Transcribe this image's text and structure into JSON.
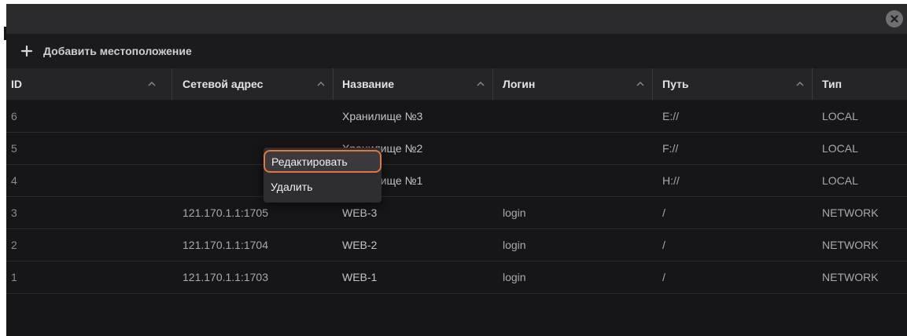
{
  "window": {
    "close_icon": "close-icon"
  },
  "toolbar": {
    "add_icon": "plus-icon",
    "add_label": "Добавить местоположение"
  },
  "table": {
    "columns": [
      {
        "label": "ID",
        "sort_icon": "chevron-up-icon"
      },
      {
        "label": "Сетевой адрес",
        "sort_icon": "chevron-up-icon"
      },
      {
        "label": "Название",
        "sort_icon": "chevron-up-icon"
      },
      {
        "label": "Логин",
        "sort_icon": "chevron-up-icon"
      },
      {
        "label": "Путь",
        "sort_icon": "chevron-up-icon"
      },
      {
        "label": "Тип"
      }
    ],
    "rows": [
      {
        "id": "6",
        "address": "",
        "name": "Хранилище №3",
        "login": "",
        "path": "E://",
        "type": "LOCAL"
      },
      {
        "id": "5",
        "address": "",
        "name": "Хранилище №2",
        "login": "",
        "path": "F://",
        "type": "LOCAL"
      },
      {
        "id": "4",
        "address": "",
        "name": "Хранилище №1",
        "login": "",
        "path": "H://",
        "type": "LOCAL"
      },
      {
        "id": "3",
        "address": "121.170.1.1:1705",
        "name": "WEB-3",
        "login": "login",
        "path": "/",
        "type": "NETWORK"
      },
      {
        "id": "2",
        "address": "121.170.1.1:1704",
        "name": "WEB-2",
        "login": "login",
        "path": "/",
        "type": "NETWORK"
      },
      {
        "id": "1",
        "address": "121.170.1.1:1703",
        "name": "WEB-1",
        "login": "login",
        "path": "/",
        "type": "NETWORK"
      }
    ]
  },
  "context_menu": {
    "edit_label": "Редактировать",
    "delete_label": "Удалить",
    "highlight_color": "#e0773b"
  }
}
